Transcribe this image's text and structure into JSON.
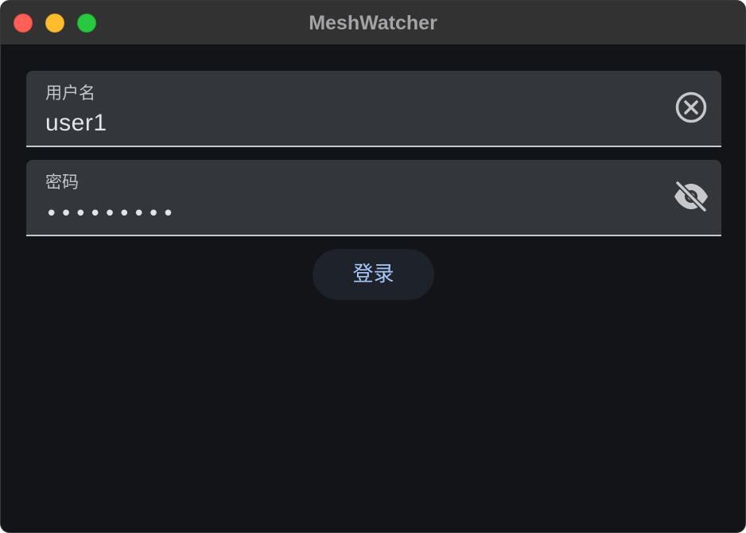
{
  "window": {
    "title": "MeshWatcher"
  },
  "form": {
    "username": {
      "label": "用户名",
      "value": "user1",
      "trailing_icon": "clear-circle-icon"
    },
    "password": {
      "label": "密码",
      "masked_value": "•••••••••",
      "trailing_icon": "visibility-off-icon"
    },
    "login_label": "登录"
  },
  "colors": {
    "background": "#121418",
    "field_background": "#33363b",
    "accent_text": "#a8c7fa"
  }
}
